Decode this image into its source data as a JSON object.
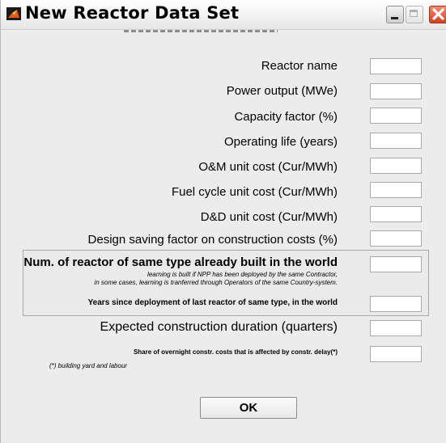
{
  "window": {
    "title": "New Reactor Data Set",
    "icon": "matlab-icon"
  },
  "form": {
    "fields": [
      {
        "label": "Reactor name",
        "value": ""
      },
      {
        "label": "Power output (MWe)",
        "value": ""
      },
      {
        "label": "Capacity factor (%)",
        "value": ""
      },
      {
        "label": "Operating life (years)",
        "value": ""
      },
      {
        "label": "O&M unit cost (Cur/MWh)",
        "value": ""
      },
      {
        "label": "Fuel cycle unit cost (Cur/MWh)",
        "value": ""
      },
      {
        "label": "D&D unit cost (Cur/MWh)",
        "value": ""
      },
      {
        "label": "Design saving factor on construction costs (%)",
        "value": ""
      }
    ],
    "learning_group": {
      "num_reactors_label": "Num. of reactor of same type already built in the world",
      "note_line1": "learning is built if NPP has been deployed by the same Contractor,",
      "note_line2": "in some cases, learning is tranferred through Operators of the same Country-system.",
      "num_reactors_value": "",
      "years_label": "Years since deployment of last reactor of same type, in the world",
      "years_value": ""
    },
    "construction_duration_label": "Expected construction duration (quarters)",
    "construction_duration_value": "",
    "overnight_share_label": "Share of overnight constr. costs that is affected by constr. delay(*)",
    "overnight_share_value": "",
    "footnote": "(*) building yard and labour"
  },
  "actions": {
    "ok_label": "OK"
  },
  "colors": {
    "window_bg": "#ececec",
    "close_button": "#d3411f"
  }
}
